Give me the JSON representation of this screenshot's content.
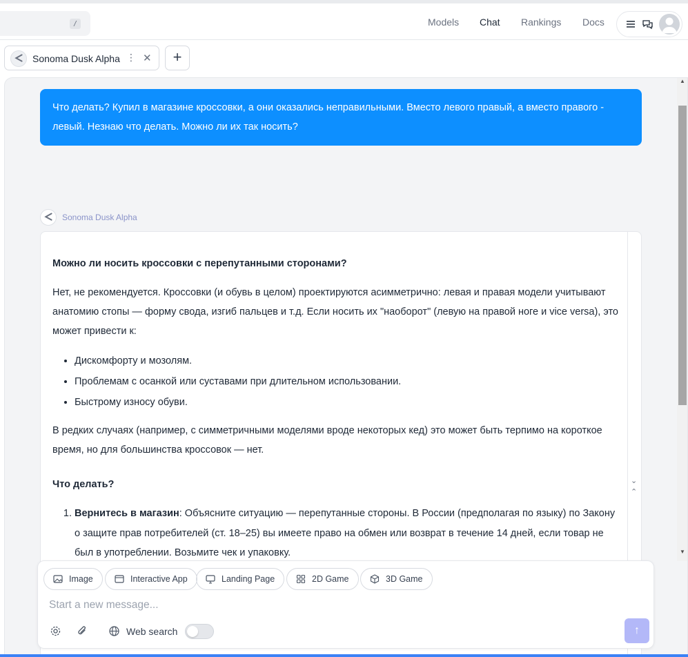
{
  "topbar": {
    "search_shortcut": "/",
    "nav": [
      "Models",
      "Chat",
      "Rankings",
      "Docs"
    ],
    "active_nav": "Chat"
  },
  "tabs": [
    {
      "label": "Sonoma Dusk Alpha",
      "kebab": "⋮",
      "close": "✕"
    }
  ],
  "add_tab_label": "+",
  "conversation": {
    "user_message": "Что делать? Купил в магазине кроссовки, а они оказались неправильными. Вместо левого правый, а вместо правого - левый. Незнаю что делать. Можно ли их так носить?",
    "assistant_name": "Sonoma Dusk Alpha",
    "assistant_response": {
      "heading1": "Можно ли носить кроссовки с перепутанными сторонами?",
      "para1": "Нет, не рекомендуется. Кроссовки (и обувь в целом) проектируются асимметрично: левая и правая модели учитывают анатомию стопы — форму свода, изгиб пальцев и т.д. Если носить их \"наоборот\" (левую на правой ноге и vice versa), это может привести к:",
      "bullets": [
        "Дискомфорту и мозолям.",
        "Проблемам с осанкой или суставами при длительном использовании.",
        "Быстрому износу обуви."
      ],
      "para2": "В редких случаях (например, с симметричными моделями вроде некоторых кед) это может быть терпимо на короткое время, но для большинства кроссовок — нет.",
      "heading2": "Что делать?",
      "steps": [
        {
          "title": "Вернитесь в магазин",
          "text": ": Объясните ситуацию — перепутанные стороны. В России (предполагая по языку) по Закону о защите прав потребителей (ст. 18–25) вы имеете право на обмен или возврат в течение 14 дней, если товар не был в употреблении. Возьмите чек и упаковку."
        }
      ]
    }
  },
  "composer": {
    "chips": [
      "Image",
      "Interactive App",
      "Landing Page",
      "2D Game",
      "3D Game"
    ],
    "placeholder": "Start a new message...",
    "web_search_label": "Web search",
    "web_search_enabled": false,
    "send_icon": "↑"
  },
  "colors": {
    "user_bubble": "#0d8fff",
    "send_button": "#b3b8f8",
    "assistant_name": "#8a93c9"
  }
}
